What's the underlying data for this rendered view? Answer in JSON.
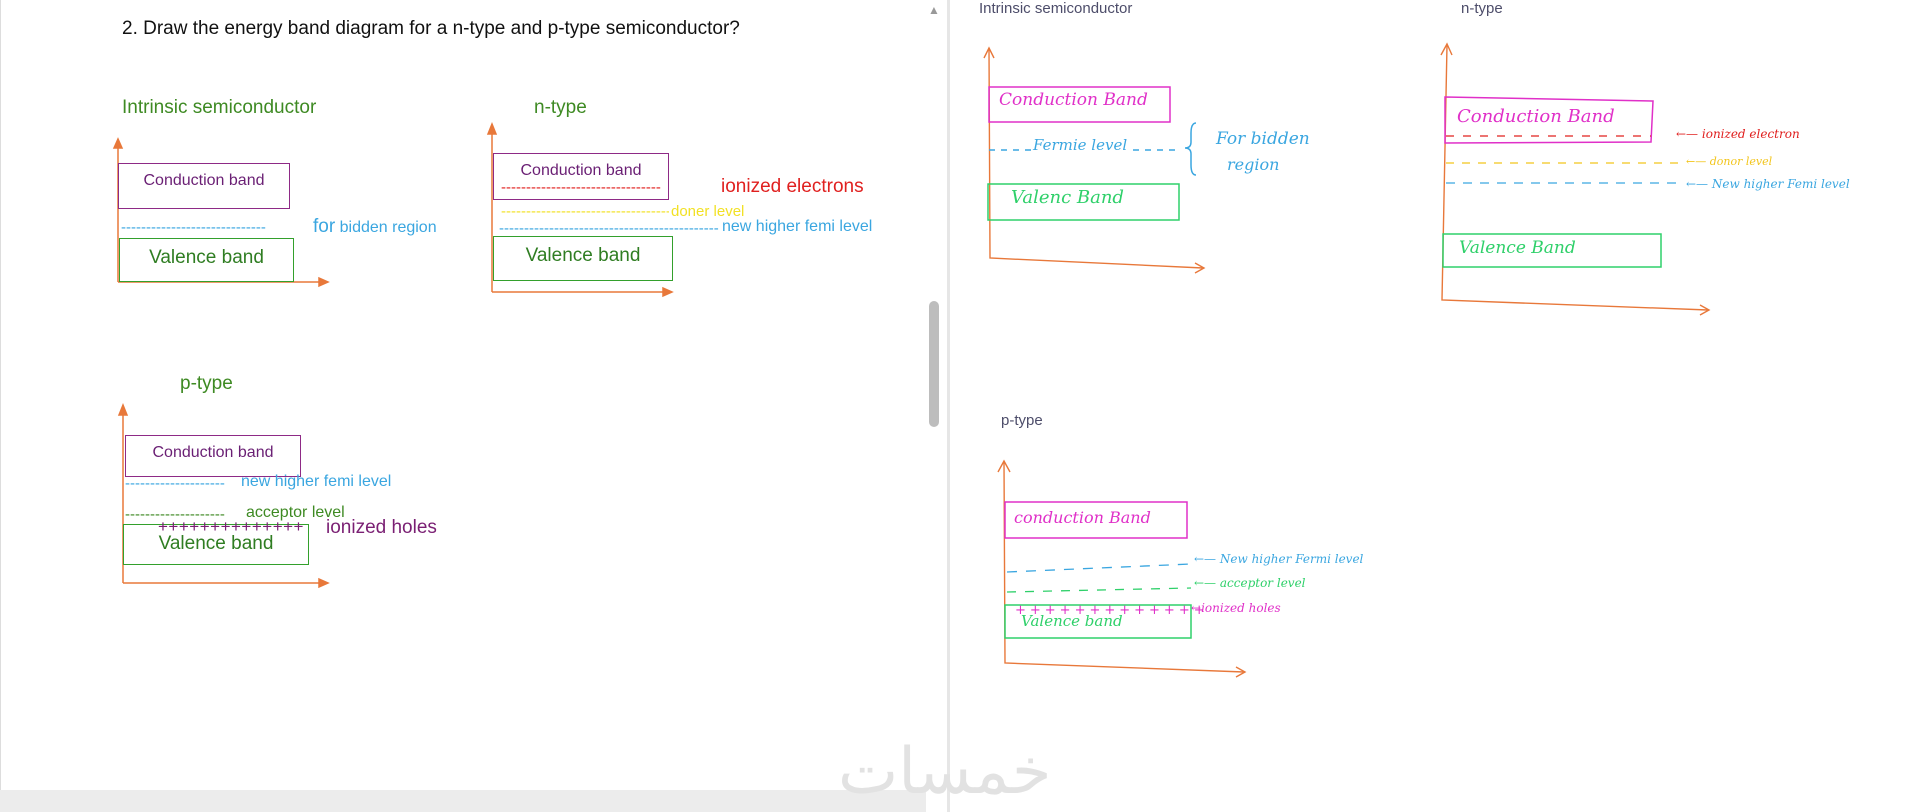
{
  "question": "2. Draw the energy band diagram for a n-type and p-type semiconductor?",
  "left": {
    "intrinsic": {
      "title": "Intrinsic semiconductor",
      "conduction": "Conduction band",
      "valence": "Valence band",
      "line_dashes": "-----------------------------",
      "label_for": "for",
      "label_rest": " bidden region"
    },
    "ntype": {
      "title": "n-type",
      "conduction": "Conduction band",
      "valence": "Valence band",
      "ionized_dashes": "--------------------------------",
      "ionized_label": "ionized electrons",
      "doner_dashes": "----------------------------------",
      "doner_label": "doner level",
      "femi_dashes": "--------------------------------------------",
      "femi_label": "new higher femi level"
    },
    "ptype": {
      "title": "p-type",
      "conduction": "Conduction band",
      "valence": "Valence band",
      "femi_dashes": "--------------------",
      "femi_label": "new higher femi level",
      "acceptor_dashes": "--------------------",
      "acceptor_label": "acceptor level",
      "holes_plus": "++++++++++++++",
      "holes_label": "ionized holes"
    }
  },
  "right": {
    "intrinsic": {
      "title": "Intrinsic semiconductor",
      "conduction": "Conduction Band",
      "fermi": "Fermie level",
      "forbidden_1": "For bidden",
      "forbidden_2": "region",
      "valence": "Valenc Band"
    },
    "ntype": {
      "title": "n-type",
      "conduction": "Conduction Band",
      "ionized": "ionized electron",
      "donor": "donor level",
      "femi": "New higher Femi level",
      "valence": "Valence Band"
    },
    "ptype": {
      "title": "p-type",
      "conduction": "conduction Band",
      "femi": "New higher Fermi level",
      "acceptor": "acceptor level",
      "holes": "ionized holes",
      "valence": "Valence band"
    }
  },
  "watermark": "خمسات",
  "colors": {
    "axis": "#e8783a",
    "conduction_border": "#8e2a86",
    "valence_border": "#33a02c",
    "femi": "#3aa6e0",
    "ionized": "#e0201f",
    "doner": "#f2e125",
    "acceptor": "#3e8a23",
    "holes": "#7a1f73",
    "hw_magenta": "#e030c8",
    "hw_green": "#2fd06a"
  }
}
